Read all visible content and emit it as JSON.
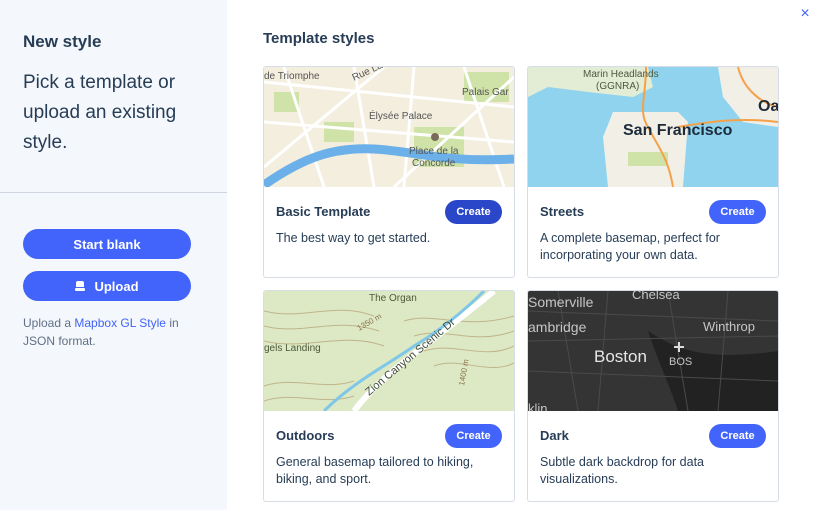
{
  "sidebar": {
    "title": "New style",
    "subtitle": "Pick a template or upload an existing style.",
    "start_blank_label": "Start blank",
    "upload_label": "Upload",
    "note_prefix": "Upload a ",
    "note_link": "Mapbox GL Style",
    "note_suffix": " in JSON format."
  },
  "close_glyph": "×",
  "main": {
    "title": "Template styles",
    "cards": [
      {
        "name": "Basic Template",
        "create_label": "Create",
        "description": "The best way to get started.",
        "map_labels": [
          "de Triomphe",
          "Rue La",
          "Palais Gar",
          "Élysée Palace",
          "Place de la",
          "Concorde"
        ]
      },
      {
        "name": "Streets",
        "create_label": "Create",
        "description": "A complete basemap, perfect for incorporating your own data.",
        "map_labels": [
          "Marin Headlands",
          "(GGNRA)",
          "San Francisco",
          "Oa"
        ]
      },
      {
        "name": "Outdoors",
        "create_label": "Create",
        "description": "General basemap tailored to hiking, biking, and sport.",
        "map_labels": [
          "The Organ",
          "gels Landing",
          "Zion Canyon Scenic Dr",
          "1350 m",
          "1400 m"
        ]
      },
      {
        "name": "Dark",
        "create_label": "Create",
        "description": "Subtle dark backdrop for data visualizations.",
        "map_labels": [
          "Somerville",
          "Chelsea",
          "ambridge",
          "Winthrop",
          "Boston",
          "BOS",
          "klin"
        ]
      }
    ]
  },
  "colors": {
    "accent": "#4264fb",
    "sidebar_bg": "#f4f7fb",
    "text": "#273d56"
  }
}
